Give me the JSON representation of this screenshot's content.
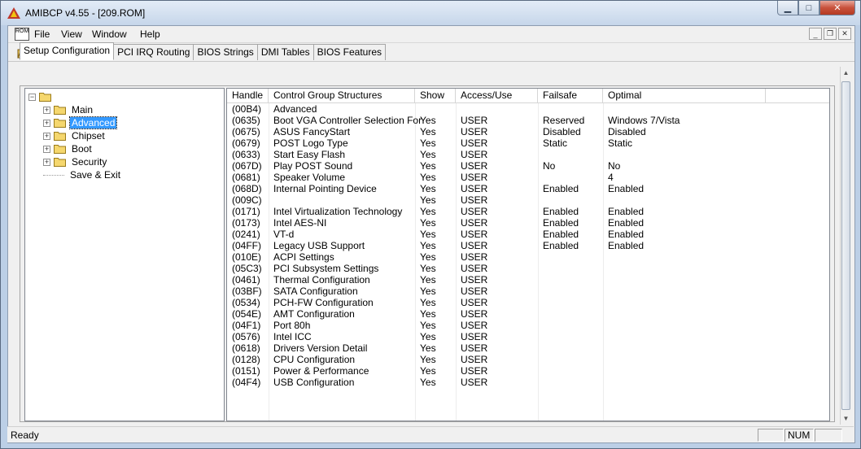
{
  "window": {
    "title": "AMIBCP v4.55 - [209.ROM]"
  },
  "menu": {
    "file": "File",
    "view": "View",
    "window": "Window",
    "help": "Help"
  },
  "rom_icon_text": "ROM",
  "tabs": [
    "Setup Configuration",
    "PCI IRQ Routing",
    "BIOS Strings",
    "DMI Tables",
    "BIOS Features"
  ],
  "tree": {
    "items": [
      "Main",
      "Advanced",
      "Chipset",
      "Boot",
      "Security",
      "Save & Exit"
    ],
    "selected": "Advanced"
  },
  "grid": {
    "columns": [
      "Handle",
      "Control Group Structures",
      "Show",
      "Access/Use",
      "Failsafe",
      "Optimal"
    ],
    "rows": [
      [
        "(00B4)",
        "Advanced",
        "",
        "",
        "",
        ""
      ],
      [
        "(0635)",
        "Boot VGA Controller Selection For",
        "Yes",
        "USER",
        "Reserved",
        "Windows 7/Vista"
      ],
      [
        "(0675)",
        "ASUS FancyStart",
        "Yes",
        "USER",
        "Disabled",
        "Disabled"
      ],
      [
        "(0679)",
        "POST Logo Type",
        "Yes",
        "USER",
        "Static",
        "Static"
      ],
      [
        "(0633)",
        "Start Easy Flash",
        "Yes",
        "USER",
        "",
        ""
      ],
      [
        "(067D)",
        "Play POST Sound",
        "Yes",
        "USER",
        "No",
        "No"
      ],
      [
        "(0681)",
        "Speaker Volume",
        "Yes",
        "USER",
        "",
        "4"
      ],
      [
        "(068D)",
        "Internal Pointing Device",
        "Yes",
        "USER",
        "Enabled",
        "Enabled"
      ],
      [
        "(009C)",
        "",
        "Yes",
        "USER",
        "",
        ""
      ],
      [
        "(0171)",
        "Intel Virtualization Technology",
        "Yes",
        "USER",
        "Enabled",
        "Enabled"
      ],
      [
        "(0173)",
        "Intel AES-NI",
        "Yes",
        "USER",
        "Enabled",
        "Enabled"
      ],
      [
        "(0241)",
        "VT-d",
        "Yes",
        "USER",
        "Enabled",
        "Enabled"
      ],
      [
        "(04FF)",
        "Legacy USB Support",
        "Yes",
        "USER",
        "Enabled",
        "Enabled"
      ],
      [
        "(010E)",
        "ACPI Settings",
        "Yes",
        "USER",
        "",
        ""
      ],
      [
        "(05C3)",
        "PCI Subsystem Settings",
        "Yes",
        "USER",
        "",
        ""
      ],
      [
        "(0461)",
        "Thermal Configuration",
        "Yes",
        "USER",
        "",
        ""
      ],
      [
        "(03BF)",
        "SATA Configuration",
        "Yes",
        "USER",
        "",
        ""
      ],
      [
        "(0534)",
        "PCH-FW Configuration",
        "Yes",
        "USER",
        "",
        ""
      ],
      [
        "(054E)",
        "AMT Configuration",
        "Yes",
        "USER",
        "",
        ""
      ],
      [
        "(04F1)",
        "Port 80h",
        "Yes",
        "USER",
        "",
        ""
      ],
      [
        "(0576)",
        "Intel ICC",
        "Yes",
        "USER",
        "",
        ""
      ],
      [
        "(0618)",
        "Drivers Version Detail",
        "Yes",
        "USER",
        "",
        ""
      ],
      [
        "(0128)",
        "CPU Configuration",
        "Yes",
        "USER",
        "",
        ""
      ],
      [
        "(0151)",
        "Power & Performance",
        "Yes",
        "USER",
        "",
        ""
      ],
      [
        "(04F4)",
        "USB Configuration",
        "Yes",
        "USER",
        "",
        ""
      ]
    ]
  },
  "status": {
    "text": "Ready",
    "num": "NUM"
  },
  "colors": {
    "selection": "#3399ff",
    "close_button": "#c8523c",
    "folder": "#f5d76e"
  }
}
